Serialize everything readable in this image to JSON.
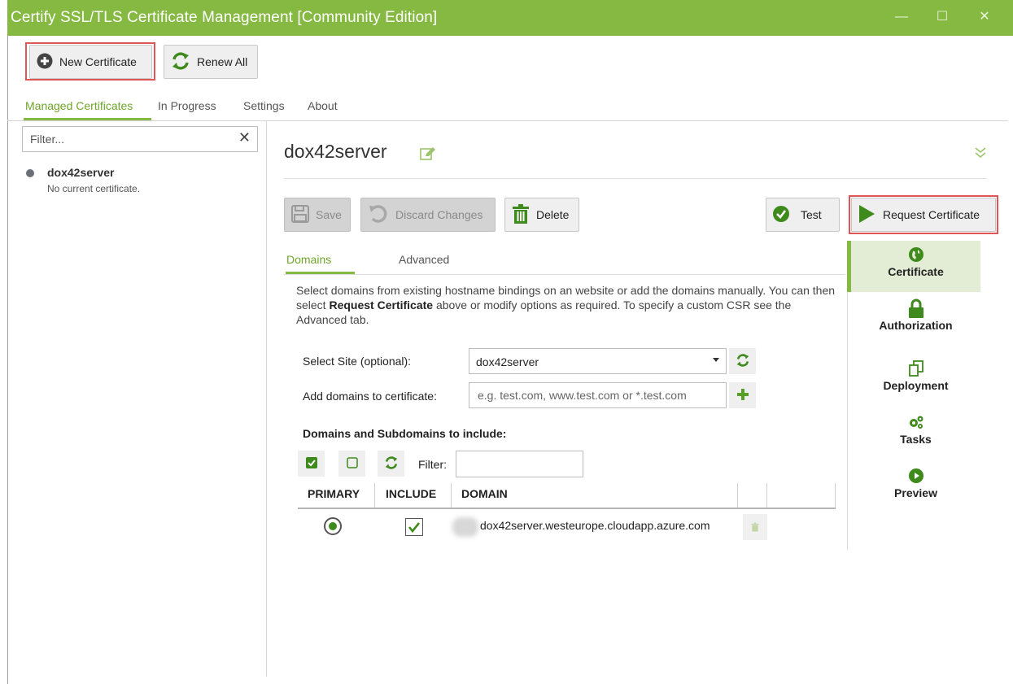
{
  "window": {
    "title": "Certify SSL/TLS Certificate Management [Community Edition]",
    "controls": {
      "minimize": "—",
      "maximize": "☐",
      "close": "✕"
    }
  },
  "toolbar": {
    "new_certificate": "New Certificate",
    "renew_all": "Renew All"
  },
  "nav_tabs": [
    {
      "label": "Managed Certificates",
      "active": true
    },
    {
      "label": "In Progress",
      "active": false
    },
    {
      "label": "Settings",
      "active": false
    },
    {
      "label": "About",
      "active": false
    }
  ],
  "sidebar": {
    "filter_placeholder": "Filter...",
    "clear_icon": "✕",
    "items": [
      {
        "name": "dox42server",
        "status": "No current certificate."
      }
    ]
  },
  "main": {
    "title": "dox42server",
    "actions": {
      "save": "Save",
      "discard": "Discard Changes",
      "delete": "Delete",
      "test": "Test",
      "request": "Request Certificate"
    },
    "tabs": [
      {
        "label": "Domains",
        "active": true
      },
      {
        "label": "Advanced",
        "active": false
      }
    ],
    "description": {
      "part1": "Select domains from existing hostname bindings on an website or add the domains manually. You can then select ",
      "bold": "Request Certificate",
      "part2": " above or modify options as required. To specify a custom CSR see the Advanced tab."
    },
    "select_site_label": "Select Site (optional):",
    "select_site_value": "dox42server",
    "add_domains_label": "Add domains to certificate:",
    "add_domains_placeholder": "e.g. test.com, www.test.com or *.test.com",
    "domains_heading": "Domains and Subdomains to include:",
    "filter_label": "Filter:",
    "table": {
      "headers": [
        "PRIMARY",
        "INCLUDE",
        "DOMAIN"
      ],
      "rows": [
        {
          "primary": true,
          "include": true,
          "domain": "dox42server.westeurope.cloudapp.azure.com"
        }
      ]
    }
  },
  "side_nav": [
    {
      "label": "Certificate",
      "icon": "globe-icon",
      "active": true
    },
    {
      "label": "Authorization",
      "icon": "lock-icon",
      "active": false
    },
    {
      "label": "Deployment",
      "icon": "copy-icon",
      "active": false
    },
    {
      "label": "Tasks",
      "icon": "gears-icon",
      "active": false
    },
    {
      "label": "Preview",
      "icon": "play-circle-icon",
      "active": false
    }
  ],
  "colors": {
    "accent": "#86b942",
    "accent_dark": "#3f8a1c",
    "highlight_border": "#e05555"
  }
}
